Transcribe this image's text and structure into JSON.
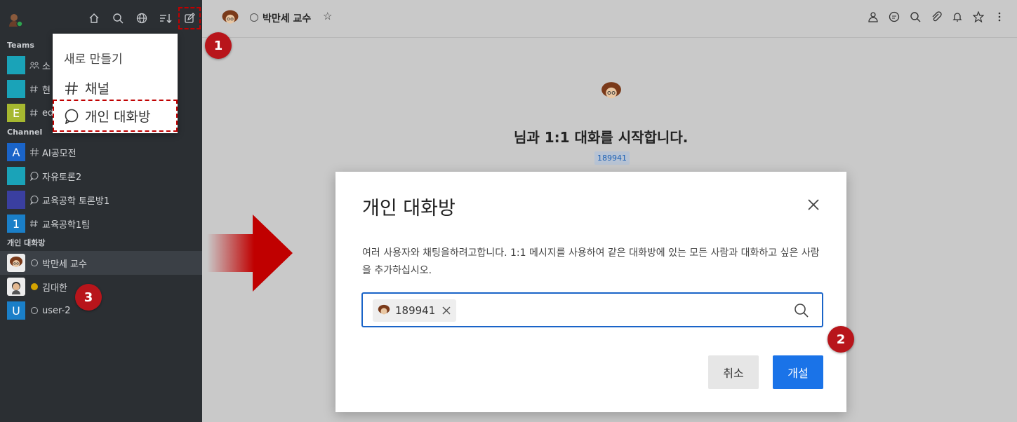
{
  "sidebar": {
    "sections": {
      "teams": "Teams",
      "channel": "Channel",
      "dm": "개인 대화방"
    },
    "teams": [
      {
        "label": "소",
        "color": "#1aa3b8",
        "initial": ""
      },
      {
        "label": "현",
        "color": "#1aa3b8",
        "initial": ""
      },
      {
        "label": "ed",
        "color": "#a6b830",
        "initial": "E"
      }
    ],
    "channels": [
      {
        "label": "AI공모전",
        "color": "#1a64c8",
        "initial": "A"
      },
      {
        "label": "자유토론2",
        "color": "#1aa3b8",
        "initial": ""
      },
      {
        "label": "교육공학 토론방1",
        "color": "#3a3fa0",
        "initial": ""
      },
      {
        "label": "교육공학1팀",
        "color": "#1a7fc8",
        "initial": "1"
      }
    ],
    "dms": [
      {
        "label": "박만세 교수"
      },
      {
        "label": "김대한"
      },
      {
        "label": "user-2",
        "initial": "U",
        "color": "#1a7fc8"
      }
    ]
  },
  "dropdown": {
    "title": "새로 만들기",
    "channel": "채널",
    "dm": "개인 대화방"
  },
  "header": {
    "name": "박만세 교수",
    "star": "☆"
  },
  "intro": {
    "text": "님과 1:1 대화를 시작합니다.",
    "tag": "189941"
  },
  "modal": {
    "title": "개인 대화방",
    "desc": "여러 사용자와 채팅을하려고합니다. 1:1 메시지를 사용하여 같은 대화방에 있는 모든 사람과 대화하고 싶은 사람을 추가하십시오.",
    "chip": "189941",
    "cancel": "취소",
    "open": "개설"
  },
  "badges": {
    "one": "1",
    "two": "2",
    "three": "3"
  },
  "colors": {
    "accent": "#1a73e8",
    "badge": "#b8151b",
    "sidebar": "#2b2f33"
  }
}
